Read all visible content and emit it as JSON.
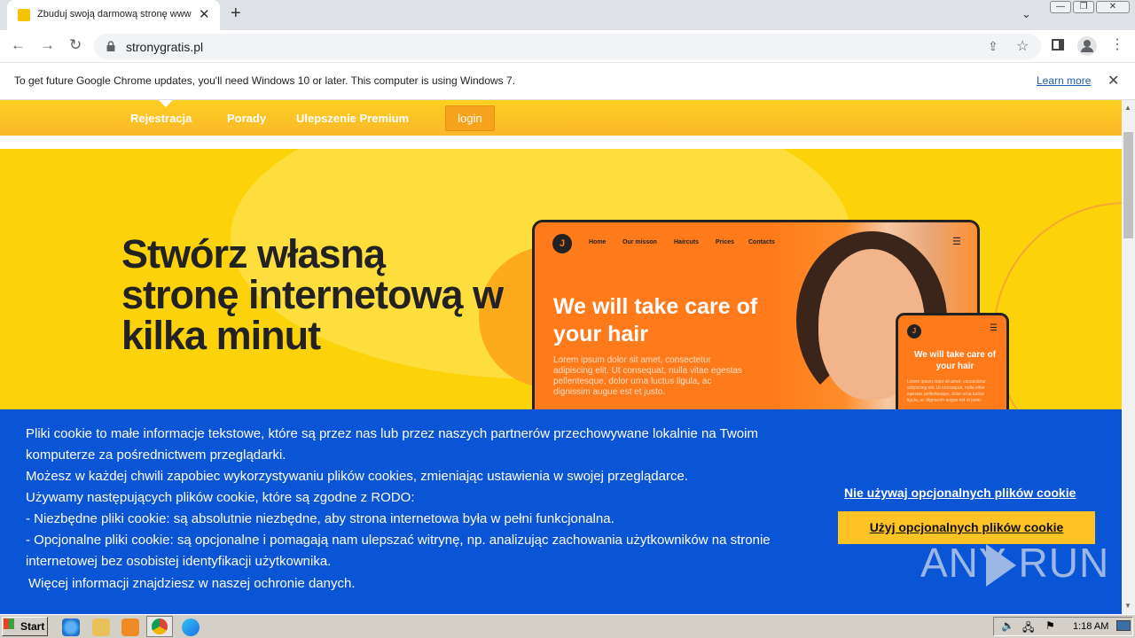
{
  "browser": {
    "tab_title": "Zbuduj swoją darmową stronę www",
    "url": "stronygratis.pl",
    "infobar_text": "To get future Google Chrome updates, you'll need Windows 10 or later. This computer is using Windows 7.",
    "infobar_link": "Learn more"
  },
  "site": {
    "nav": [
      "Rejestracja",
      "Porady",
      "Ulepszenie Premium"
    ],
    "login_label": "login",
    "hero_title": "Stwórz własną stronę internetową w kilka minut",
    "mockup": {
      "logo": "J",
      "nav": [
        "Home",
        "Our misson",
        "Haircuts",
        "Prices",
        "Contacts"
      ],
      "headline": "We will take care of your hair",
      "body": "Lorem ipsum dolor sit amet, consectetur adipiscing elit. Ut consequat, nulla vitae egestas pellentesque, dolor urna luctus ligula, ac dignissim augue est et justo.",
      "phone_headline": "We will take care of your hair",
      "phone_body": "Lorem ipsum dolor sit amet, consectetur adipiscing elit. Ut consequat, nulla vitae egestas pellentesque, dolor urna luctus ligula, ac dignissim augue est et justo."
    }
  },
  "cookie": {
    "lines": [
      "Pliki cookie to małe informacje tekstowe, które są przez nas lub przez naszych partnerów przechowywane lokalnie na Twoim komputerze za pośrednictwem przeglądarki.",
      "Możesz w każdej chwili zapobiec wykorzystywaniu plików cookies, zmieniając ustawienia w swojej przeglądarce.",
      "Używamy następujących plików cookie, które są zgodne z RODO:",
      "- Niezbędne pliki cookie: są absolutnie niezbędne, aby strona internetowa była w pełni funkcjonalna.",
      "- Opcjonalne pliki cookie: są opcjonalne i pomagają nam ulepszać witrynę, np. analizując zachowania użytkowników na stronie internetowej bez osobistej identyfikacji użytkownika."
    ],
    "more_info": "Więcej informacji znajdziesz w naszej ochronie danych.",
    "decline_label": "Nie używaj opcjonalnych plików cookie",
    "accept_label": "Użyj opcjonalnych plików cookie",
    "watermark": "ANY RUN"
  },
  "taskbar": {
    "start_label": "Start",
    "clock": "1:18 AM"
  },
  "colors": {
    "accent_yellow": "#fcd30b",
    "cookie_blue": "#0a55d6",
    "accept_button": "#ffc326",
    "mock_orange": "#ff7a1a"
  }
}
